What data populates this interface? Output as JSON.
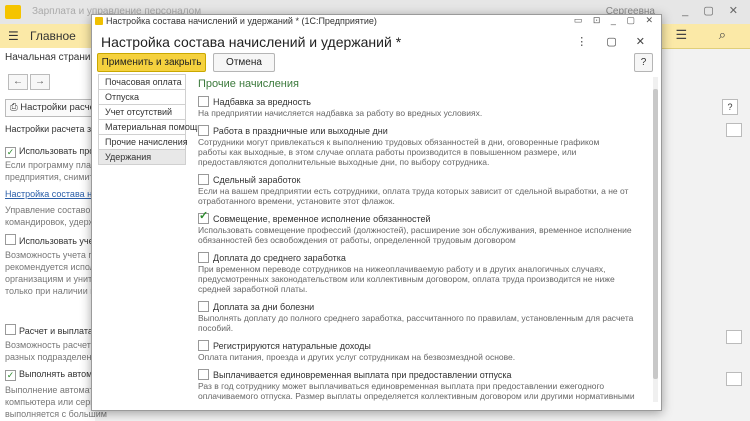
{
  "background": {
    "window_title": "Зарплата и управление персоналом",
    "user": "Сергеевна",
    "toolbar_home": "Главное",
    "tab": "Начальная страница",
    "settings_button": "Настройки расчета",
    "lines": [
      {
        "text": "Настройки расчета зар",
        "style": "plain"
      },
      {
        "text": "Использовать прогр",
        "style": "checkbox",
        "checked": true
      },
      {
        "text": "Если программу планир",
        "style": "grey"
      },
      {
        "text": "предприятия, снимите ф",
        "style": "grey"
      },
      {
        "text": "Настройка состава начисл",
        "style": "link"
      },
      {
        "text": "Управление составом и",
        "style": "grey"
      },
      {
        "text": "командировок, удержан",
        "style": "grey"
      },
      {
        "text": "Использовать учет",
        "style": "checkbox",
        "checked": false
      },
      {
        "text": "Возможность учета по с",
        "style": "grey"
      },
      {
        "text": "рекомендуется использ",
        "style": "grey"
      },
      {
        "text": "организациям и унитарн",
        "style": "grey"
      },
      {
        "text": "только при наличии цел",
        "style": "grey"
      },
      {
        "text": "Расчет и выплата за",
        "style": "checkbox",
        "checked": false
      },
      {
        "text": "Возможность расчета и",
        "style": "grey"
      },
      {
        "text": "разных подразделениях",
        "style": "grey"
      },
      {
        "text": "Выполнять автомат",
        "style": "checkbox",
        "checked": true
      },
      {
        "text": "Выполнение автомати",
        "style": "grey"
      },
      {
        "text": "компьютера или сервер",
        "style": "grey"
      },
      {
        "text": "выполняется с большим",
        "style": "grey"
      }
    ]
  },
  "modal": {
    "window_title": "Настройка состава начислений и удержаний * (1С:Предприятие)",
    "header": "Настройка состава начислений и удержаний *",
    "buttons": {
      "apply_close": "Применить и закрыть",
      "cancel": "Отмена",
      "help": "?"
    },
    "nav": [
      {
        "label": "Почасовая оплата",
        "active": false
      },
      {
        "label": "Отпуска",
        "active": false
      },
      {
        "label": "Учет отсутствий",
        "active": false
      },
      {
        "label": "Материальная помощь",
        "active": false
      },
      {
        "label": "Прочие начисления",
        "active": false
      },
      {
        "label": "Удержания",
        "active": true
      }
    ],
    "section_title": "Прочие начисления",
    "items": [
      {
        "label": "Надбавка за вредность",
        "checked": false,
        "desc": [
          "На предприятии начисляется надбавка за работу во вредных условиях."
        ]
      },
      {
        "label": "Работа в праздничные или выходные дни",
        "checked": false,
        "desc": [
          "Сотрудники могут привлекаться к выполнению трудовых обязанностей в дни, оговоренные графиком",
          "работы как выходные, в этом случае оплата работы производится в повышенном размере, или",
          "предоставляются дополнительные выходные дни, по выбору сотрудника."
        ]
      },
      {
        "label": "Сдельный заработок",
        "checked": false,
        "desc": [
          "Если на вашем предприятии есть сотрудники, оплата труда которых зависит от сдельной выработки, а не от",
          "отработанного времени, установите этот флажок."
        ]
      },
      {
        "label": "Совмещение, временное исполнение обязанностей",
        "checked": true,
        "desc": [
          "Использовать совмещение профессий (должностей), расширение зон обслуживания, временное исполнение",
          "обязанностей без освобождения от работы, определенной трудовым договором"
        ]
      },
      {
        "label": "Доплата до среднего заработка",
        "checked": false,
        "desc": [
          "При временном переводе сотрудников на нижеоплачиваемую работу и в других аналогичных случаях,",
          "предусмотренных законодательством или коллективным договором, оплата труда производится не ниже",
          "средней заработной платы."
        ]
      },
      {
        "label": "Доплата за дни болезни",
        "checked": false,
        "desc": [
          "Выполнять доплату до полного среднего заработка, рассчитанного по правилам, установленным для расчета",
          "пособий."
        ]
      },
      {
        "label": "Регистрируются натуральные доходы",
        "checked": false,
        "desc": [
          "Оплата питания, проезда и других услуг сотрудникам на безвозмездной основе."
        ]
      },
      {
        "label": "Выплачивается единовременная выплата при предоставлении отпуска",
        "checked": false,
        "desc": [
          "Раз в год сотруднику может выплачиваться единовременная выплата при предоставлении ежегодного",
          "оплачиваемого отпуска. Размер выплаты определяется коллективным договором или другими нормативными",
          "документами."
        ]
      }
    ]
  }
}
